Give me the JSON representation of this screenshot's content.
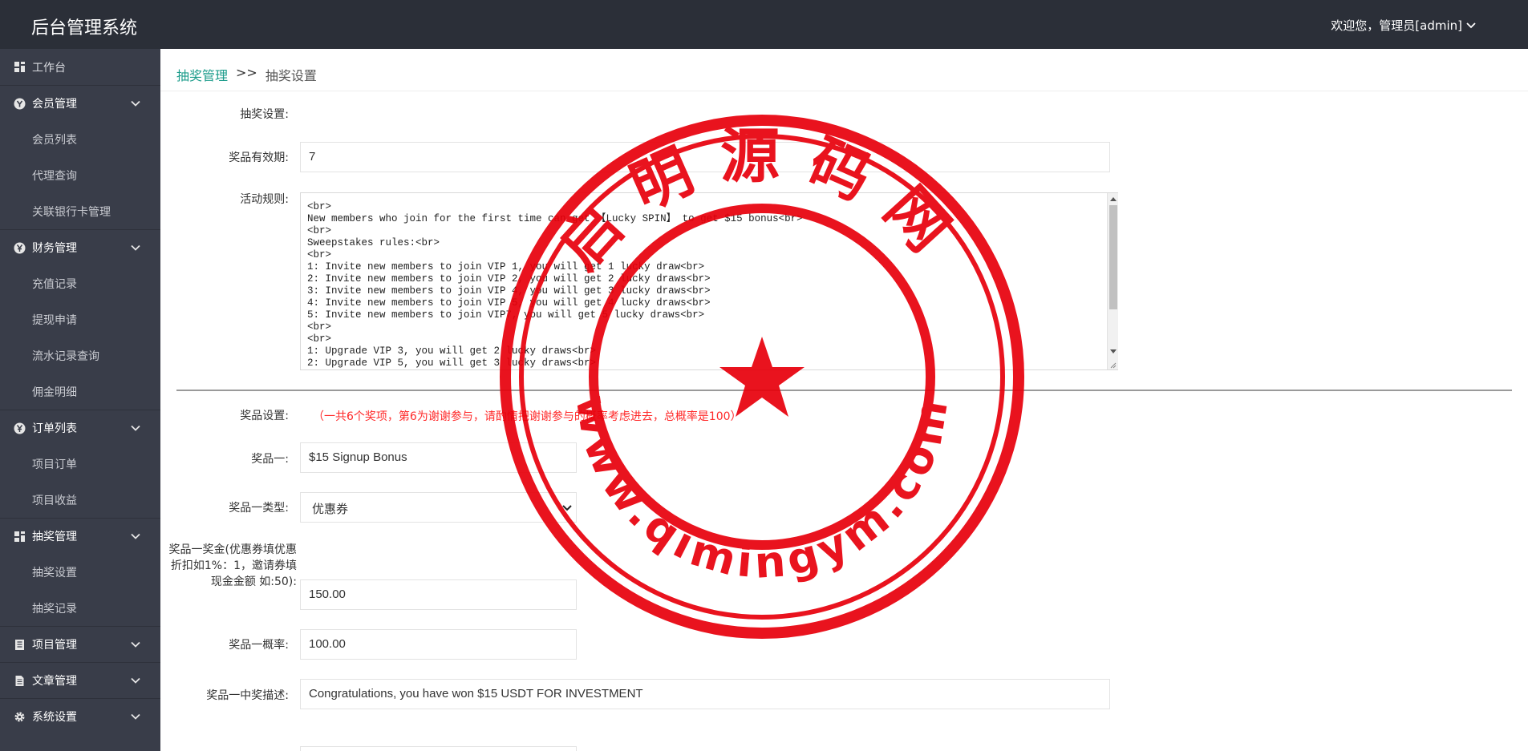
{
  "header": {
    "brand": "后台管理系统",
    "user": "欢迎您，管理员[admin]"
  },
  "sidebar": {
    "items": [
      {
        "type": "first",
        "icon": "dashboard-icon",
        "label": "工作台"
      },
      {
        "type": "group",
        "icon": "user-circle-icon",
        "label": "会员管理"
      },
      {
        "type": "sub",
        "label": "会员列表"
      },
      {
        "type": "sub",
        "label": "代理查询"
      },
      {
        "type": "sub",
        "label": "关联银行卡管理"
      },
      {
        "type": "group",
        "icon": "yen-icon",
        "label": "财务管理"
      },
      {
        "type": "sub",
        "label": "充值记录"
      },
      {
        "type": "sub",
        "label": "提现申请"
      },
      {
        "type": "sub",
        "label": "流水记录查询"
      },
      {
        "type": "sub",
        "label": "佣金明细"
      },
      {
        "type": "group",
        "icon": "yen-icon",
        "label": "订单列表"
      },
      {
        "type": "sub",
        "label": "项目订单"
      },
      {
        "type": "sub",
        "label": "项目收益"
      },
      {
        "type": "group",
        "icon": "dashboard-icon",
        "label": "抽奖管理"
      },
      {
        "type": "sub",
        "label": "抽奖设置"
      },
      {
        "type": "sub",
        "label": "抽奖记录"
      },
      {
        "type": "group",
        "icon": "book-icon",
        "label": "项目管理"
      },
      {
        "type": "group",
        "icon": "document-icon",
        "label": "文章管理"
      },
      {
        "type": "group",
        "icon": "gear-icon",
        "label": "系统设置"
      }
    ]
  },
  "breadcrumb": {
    "parent": "抽奖管理",
    "separator": ">>",
    "current": "抽奖设置"
  },
  "form": {
    "section_label": "抽奖设置:",
    "validity_label": "奖品有效期:",
    "validity_value": "7",
    "rules_label": "活动规则:",
    "rules_lines": [
      "<br>",
      "New members who join for the first time can get 【Lucky SPIN】 to get $15 bonus<br>",
      "<br>",
      "Sweepstakes rules:<br>",
      "<br>",
      "1: Invite new members to join VIP 1, you will get 1 lucky draw<br>",
      "2: Invite new members to join VIP 2, you will get 2 lucky draws<br>",
      "3: Invite new members to join VIP 4, you will get 3 lucky draws<br>",
      "4: Invite new members to join VIP 5, you will get 4 lucky draws<br>",
      "5: Invite new members to join VIP7, you will get 5 lucky draws<br>",
      "<br>",
      "<br>",
      "1: Upgrade VIP 3, you will get 2 lucky draws<br>",
      "2: Upgrade VIP 5, you will get 3 lucky draws<br>"
    ],
    "prize_section_label": "奖品设置:",
    "prize_note": "（一共6个奖项，第6为谢谢参与，请酌情把谢谢参与的概率考虑进去，总概率是100）",
    "prize1_label": "奖品一:",
    "prize1_value": "$15 Signup Bonus",
    "prize1_type_label": "奖品一类型:",
    "prize1_type_value": "优惠券",
    "prize1_amount_label": "奖品一奖金(优惠券填优惠折扣如1%：1，邀请券填现金金额 如:50):",
    "prize1_amount_value": "150.00",
    "prize1_prob_label": "奖品一概率:",
    "prize1_prob_value": "100.00",
    "prize1_desc_label": "奖品一中奖描述:",
    "prize1_desc_value": "Congratulations, you have won $15 USDT FOR INVESTMENT"
  },
  "watermark": {
    "top_text": "启明源码网",
    "bottom_text": "www.qimingym.com",
    "color": "#e8000b"
  }
}
